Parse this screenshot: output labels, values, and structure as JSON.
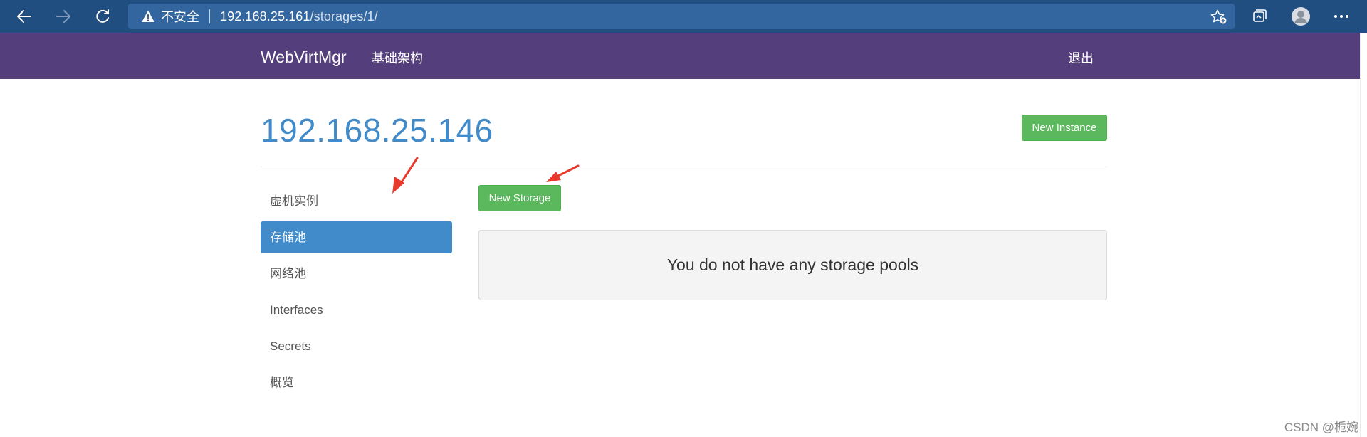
{
  "browser": {
    "insecure_label": "不安全",
    "url_host": "192.168.25.161",
    "url_path": "/storages/1/",
    "icons": {
      "back": "back-arrow-icon",
      "forward": "forward-arrow-icon",
      "refresh": "refresh-icon",
      "warning": "warning-triangle-icon",
      "favorites": "add-favorite-star-icon",
      "collections": "collections-icon",
      "profile": "profile-avatar-icon",
      "menu": "more-menu-icon"
    }
  },
  "navbar": {
    "brand": "WebVirtMgr",
    "nav_link": "基础架构",
    "logout": "退出"
  },
  "page": {
    "title": "192.168.25.146",
    "new_instance_label": "New Instance",
    "new_storage_label": "New Storage",
    "empty_message": "You do not have any storage pools"
  },
  "sidebar": {
    "items": [
      {
        "label": "虚机实例",
        "active": false
      },
      {
        "label": "存储池",
        "active": true
      },
      {
        "label": "网络池",
        "active": false
      },
      {
        "label": "Interfaces",
        "active": false
      },
      {
        "label": "Secrets",
        "active": false
      },
      {
        "label": "概览",
        "active": false
      }
    ]
  },
  "watermark": "CSDN @栀婉",
  "colors": {
    "browser_bar": "#214e80",
    "address_bar": "#33669f",
    "navbar": "#553e7c",
    "title_blue": "#428bca",
    "button_green": "#5cb85c",
    "active_item": "#428bca",
    "annotation_red": "#e8392d"
  }
}
